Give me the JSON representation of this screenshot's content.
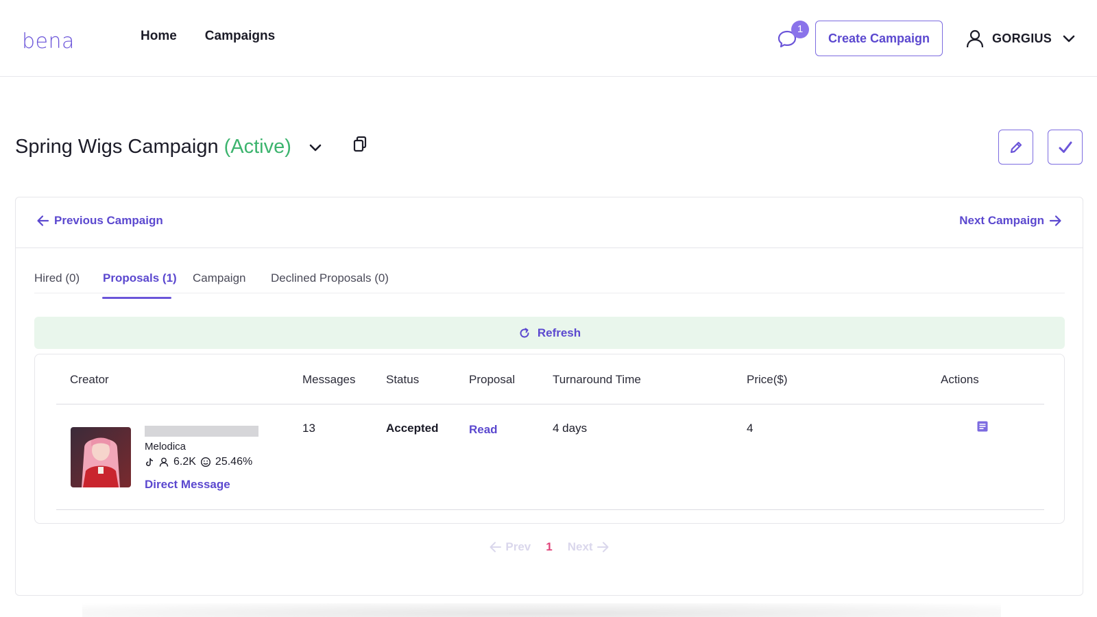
{
  "header": {
    "logo": "bena",
    "nav": [
      {
        "label": "Home"
      },
      {
        "label": "Campaigns"
      }
    ],
    "notification_count": "1",
    "create_campaign_label": "Create Campaign",
    "user_name": "GORGIUS"
  },
  "campaign": {
    "title": "Spring Wigs Campaign",
    "status": "(Active)",
    "prev_label": "Previous Campaign",
    "next_label": "Next Campaign"
  },
  "tabs": [
    {
      "label": "Hired (0)",
      "active": false
    },
    {
      "label": "Proposals (1)",
      "active": true
    },
    {
      "label": "Campaign",
      "active": false
    },
    {
      "label": "Declined Proposals (0)",
      "active": false
    }
  ],
  "refresh_label": "Refresh",
  "table": {
    "columns": [
      "Creator",
      "Messages",
      "Status",
      "Proposal",
      "Turnaround Time",
      "Price($)",
      "Actions"
    ],
    "rows": [
      {
        "creator_name": "Melodica",
        "followers": "6.2K",
        "engagement": "25.46%",
        "direct_message": "Direct Message",
        "messages": "13",
        "status": "Accepted",
        "proposal": "Read",
        "turnaround": "4 days",
        "price": "4"
      }
    ]
  },
  "pagination": {
    "prev": "Prev",
    "current": "1",
    "next": "Next"
  },
  "colors": {
    "accent": "#5b48cf",
    "active_status": "#3cb46e",
    "refresh_bg": "#e9f6ec",
    "page_current": "#e0457b"
  },
  "icons": [
    "chat-icon",
    "user-icon",
    "chevron-down-icon",
    "copy-icon",
    "pencil-icon",
    "check-icon",
    "arrow-left-icon",
    "arrow-right-icon",
    "refresh-icon",
    "tiktok-icon",
    "followers-icon",
    "engagement-icon",
    "document-icon"
  ]
}
